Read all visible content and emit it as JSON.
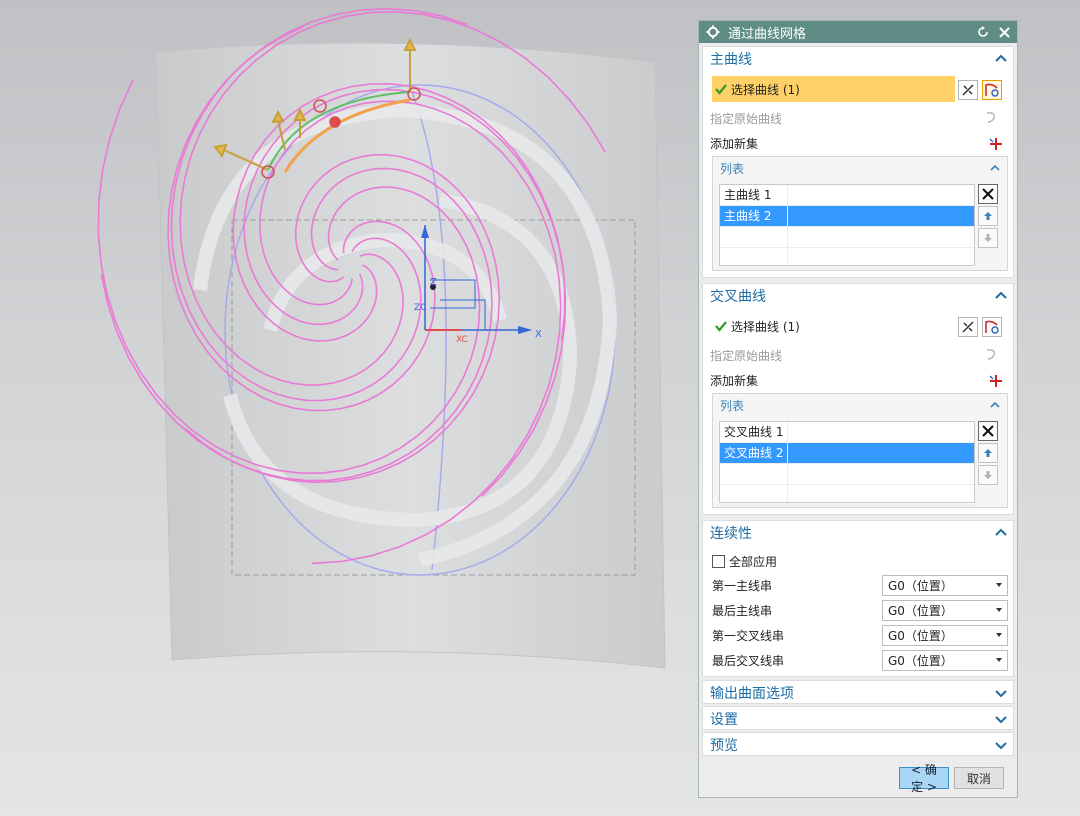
{
  "dialog": {
    "title": "通过曲线网格",
    "icons": {
      "title": "gear-icon",
      "reset": "reset-icon",
      "close": "close-icon"
    }
  },
  "primary": {
    "title": "主曲线",
    "select_label": "选择曲线 (1)",
    "specify_origin": "指定原始曲线",
    "add_new_set": "添加新集",
    "list_title": "列表",
    "items": [
      "主曲线 1",
      "主曲线 2"
    ],
    "selected_index": 1
  },
  "cross": {
    "title": "交叉曲线",
    "select_label": "选择曲线 (1)",
    "specify_origin": "指定原始曲线",
    "add_new_set": "添加新集",
    "list_title": "列表",
    "items": [
      "交叉曲线 1",
      "交叉曲线 2"
    ],
    "selected_index": 1
  },
  "continuity": {
    "title": "连续性",
    "apply_all": "全部应用",
    "apply_all_checked": false,
    "rows": [
      {
        "label": "第一主线串",
        "value": "G0（位置）"
      },
      {
        "label": "最后主线串",
        "value": "G0（位置）"
      },
      {
        "label": "第一交叉线串",
        "value": "G0（位置）"
      },
      {
        "label": "最后交叉线串",
        "value": "G0（位置）"
      }
    ]
  },
  "collapsed_sections": [
    "输出曲面选项",
    "设置",
    "预览"
  ],
  "buttons": {
    "ok": "< 确定 >",
    "cancel": "取消"
  },
  "viewport": {
    "axis_labels": {
      "x": "X",
      "xc": "XC",
      "zc": "ZC",
      "z": "Z"
    },
    "colors": {
      "spiral": "#e97ad6",
      "guide": "#a7a6ee",
      "highlight_green": "#5fbf6a",
      "highlight_orange": "#f2a24a",
      "surface": "#d4d6d8"
    }
  },
  "colors": {
    "title_bar": "#5f8d86",
    "section_title": "#1f6ea3",
    "selected_row": "#ffd166",
    "list_selected": "#3399ff"
  }
}
